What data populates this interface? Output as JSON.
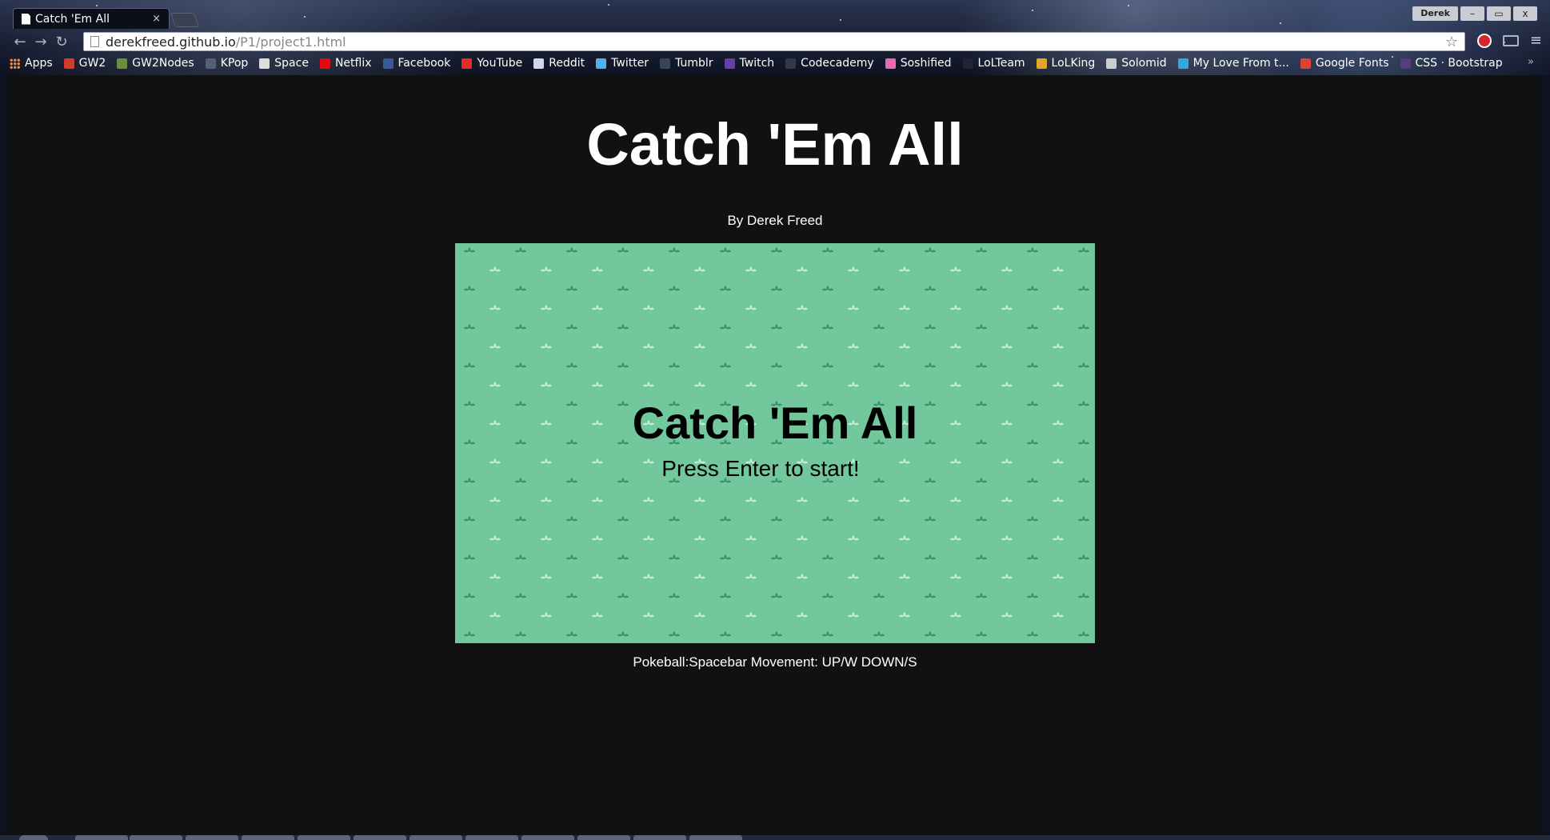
{
  "browser": {
    "tab": {
      "title": "Catch 'Em All",
      "close_glyph": "×"
    },
    "profile_name": "Derek",
    "window_controls": {
      "minimize": "–",
      "maximize": "▭",
      "close": "x"
    },
    "nav": {
      "back": "←",
      "forward": "→",
      "reload": "↻"
    },
    "address": {
      "host": "derekfreed.github.io",
      "path": "/P1/project1.html",
      "star_glyph": "☆"
    },
    "menu_glyph": "≡",
    "bookmarks": [
      {
        "label": "Apps",
        "icon": "apps-grid-icon",
        "color": "#e8833a"
      },
      {
        "label": "GW2",
        "icon": "gw2-icon",
        "color": "#d23c2a"
      },
      {
        "label": "GW2Nodes",
        "icon": "gw2nodes-icon",
        "color": "#6b8e3a"
      },
      {
        "label": "KPop",
        "icon": "kpop-icon",
        "color": "#556070"
      },
      {
        "label": "Space",
        "icon": "space-icon",
        "color": "#dddddd"
      },
      {
        "label": "Netflix",
        "icon": "netflix-icon",
        "color": "#e50914"
      },
      {
        "label": "Facebook",
        "icon": "facebook-icon",
        "color": "#3b5998"
      },
      {
        "label": "YouTube",
        "icon": "youtube-icon",
        "color": "#e52d27"
      },
      {
        "label": "Reddit",
        "icon": "reddit-icon",
        "color": "#cfd8e6"
      },
      {
        "label": "Twitter",
        "icon": "twitter-icon",
        "color": "#55acee"
      },
      {
        "label": "Tumblr",
        "icon": "tumblr-icon",
        "color": "#35465c"
      },
      {
        "label": "Twitch",
        "icon": "twitch-icon",
        "color": "#6441a5"
      },
      {
        "label": "Codecademy",
        "icon": "codecademy-icon",
        "color": "#333a45"
      },
      {
        "label": "Soshified",
        "icon": "soshified-icon",
        "color": "#e86ab4"
      },
      {
        "label": "LoLTeam",
        "icon": "lolteam-icon",
        "color": "#223"
      },
      {
        "label": "LoLKing",
        "icon": "lolking-icon",
        "color": "#e0a72b"
      },
      {
        "label": "Solomid",
        "icon": "solomid-icon",
        "color": "#cccccc"
      },
      {
        "label": "My Love From t...",
        "icon": "viki-icon",
        "color": "#2fa9e0"
      },
      {
        "label": "Google Fonts",
        "icon": "google-fonts-icon",
        "color": "#d9433a"
      },
      {
        "label": "CSS · Bootstrap",
        "icon": "bootstrap-icon",
        "color": "#563d7c"
      }
    ],
    "bookmarks_overflow": "»"
  },
  "page": {
    "title": "Catch 'Em All",
    "byline": "By Derek Freed",
    "canvas": {
      "title": "Catch 'Em All",
      "prompt": "Press Enter to start!",
      "background_color": "#73c79c"
    },
    "controls_help": "Pokeball:Spacebar Movement: UP/W DOWN/S"
  },
  "colors": {
    "page_background": "#111111",
    "text": "#ffffff"
  }
}
